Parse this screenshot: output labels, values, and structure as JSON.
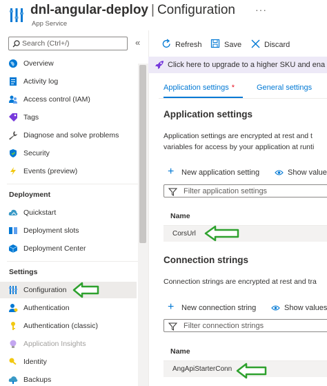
{
  "header": {
    "resource_name": "dnl-angular-deploy",
    "separator": "|",
    "page_name": "Configuration",
    "more": "···",
    "subtitle": "App Service"
  },
  "sidebar": {
    "search_placeholder": "Search (Ctrl+/)",
    "collapse": "«",
    "items": [
      {
        "label": "Overview",
        "icon": "globe-icon"
      },
      {
        "label": "Activity log",
        "icon": "activity-log-icon"
      },
      {
        "label": "Access control (IAM)",
        "icon": "people-icon"
      },
      {
        "label": "Tags",
        "icon": "tag-icon"
      },
      {
        "label": "Diagnose and solve problems",
        "icon": "wrench-icon"
      },
      {
        "label": "Security",
        "icon": "shield-icon"
      },
      {
        "label": "Events (preview)",
        "icon": "lightning-icon"
      }
    ],
    "deployment_section": "Deployment",
    "deployment_items": [
      {
        "label": "Quickstart",
        "icon": "cloud-icon"
      },
      {
        "label": "Deployment slots",
        "icon": "slots-icon"
      },
      {
        "label": "Deployment Center",
        "icon": "cube-icon"
      }
    ],
    "settings_section": "Settings",
    "settings_items": [
      {
        "label": "Configuration",
        "icon": "sliders-icon",
        "active": true
      },
      {
        "label": "Authentication",
        "icon": "person-icon"
      },
      {
        "label": "Authentication (classic)",
        "icon": "key-icon"
      },
      {
        "label": "Application Insights",
        "icon": "lightbulb-icon",
        "disabled": true
      },
      {
        "label": "Identity",
        "icon": "identity-key-icon"
      },
      {
        "label": "Backups",
        "icon": "backup-icon"
      }
    ]
  },
  "toolbar": {
    "refresh": "Refresh",
    "save": "Save",
    "discard": "Discard"
  },
  "banner": {
    "text": "Click here to upgrade to a higher SKU and ena"
  },
  "tabs": {
    "app_settings": "Application settings",
    "app_settings_marker": "*",
    "general_settings": "General settings"
  },
  "app_settings": {
    "heading": "Application settings",
    "desc_line1": "Application settings are encrypted at rest and t",
    "desc_line2": "variables for access by your application at runti",
    "new_button": "New application setting",
    "show_values": "Show value",
    "filter_placeholder": "Filter application settings",
    "column_name": "Name",
    "rows": [
      "CorsUrl"
    ]
  },
  "connection_strings": {
    "heading": "Connection strings",
    "desc_line1": "Connection strings are encrypted at rest and tra",
    "new_button": "New connection string",
    "show_values": "Show values",
    "filter_placeholder": "Filter connection strings",
    "column_name": "Name",
    "rows": [
      "AngApiStarterConn"
    ]
  },
  "colors": {
    "accent": "#0078d4",
    "annotation_arrow": "#2ea12e",
    "banner_bg": "#ede9f7"
  }
}
